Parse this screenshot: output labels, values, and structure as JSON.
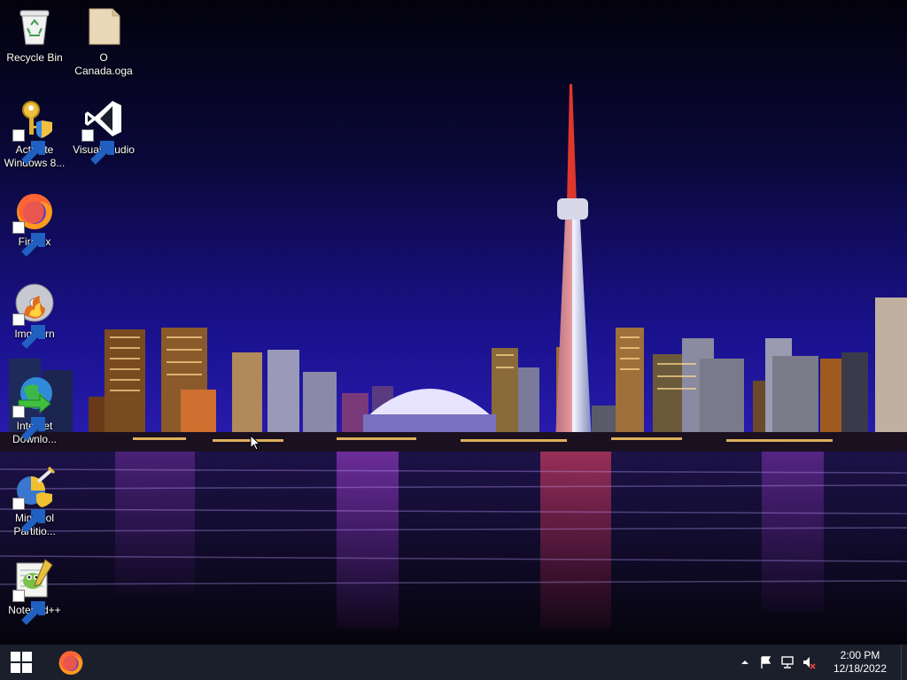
{
  "desktop": {
    "icons": [
      {
        "label": "Recycle Bin",
        "icon": "recycle-bin-icon",
        "shortcut": false
      },
      {
        "label": "O\nCanada.oga",
        "icon": "audio-file-icon",
        "shortcut": false
      },
      {
        "label": "Activate\nWindows 8...",
        "icon": "key-shield-icon",
        "shortcut": true
      },
      {
        "label": "Visual Studio",
        "icon": "visual-studio-icon",
        "shortcut": true
      },
      {
        "label": "Firefox",
        "icon": "firefox-icon",
        "shortcut": true
      },
      {
        "label": "ImgBurn",
        "icon": "disc-burn-icon",
        "shortcut": true
      },
      {
        "label": "Internet\nDownlo...",
        "icon": "internet-download-manager-icon",
        "shortcut": true
      },
      {
        "label": "MiniTool\nPartitio...",
        "icon": "partition-wizard-icon",
        "shortcut": true
      },
      {
        "label": "Notepad++",
        "icon": "notepad-plus-plus-icon",
        "shortcut": true
      }
    ],
    "wallpaper": "toronto-skyline-night"
  },
  "taskbar": {
    "start": "windows-start-icon",
    "pinned": [
      {
        "icon": "firefox-icon"
      }
    ],
    "tray": {
      "icons": [
        "show-hidden-icons-chevron",
        "action-center-flag-icon",
        "network-icon",
        "volume-muted-icon"
      ],
      "time": "2:00 PM",
      "date": "12/18/2022"
    }
  },
  "colors": {
    "taskbar": "#1b1f2c",
    "sky_top": "#03020c",
    "sky_bottom": "#1a1290",
    "tower_red": "#e0372c",
    "text": "#ffffff"
  }
}
